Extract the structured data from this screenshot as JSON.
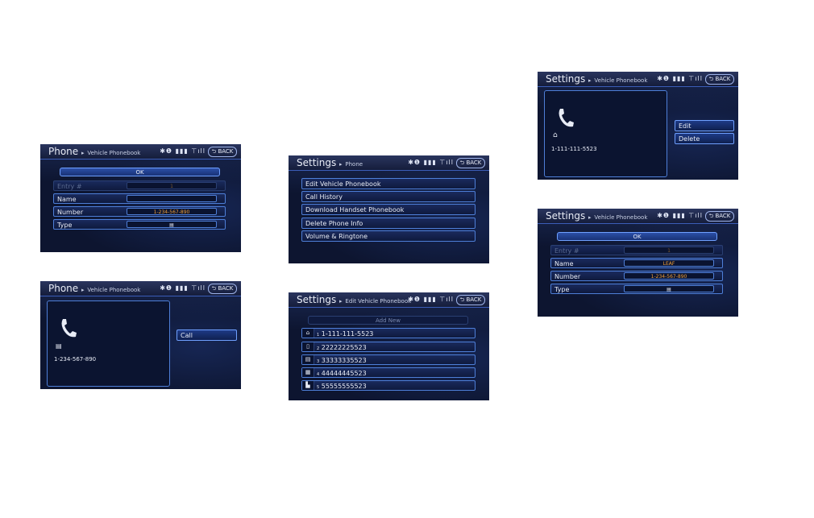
{
  "screens": {
    "a": {
      "title": "Phone",
      "subtitle": "Vehicle Phonebook",
      "back": "BACK",
      "ok": "OK",
      "rows": [
        {
          "label": "Entry #",
          "value": "1",
          "disabled": true
        },
        {
          "label": "Name",
          "value": ""
        },
        {
          "label": "Number",
          "value": "1-234-567-890"
        },
        {
          "label": "Type",
          "value": "▤"
        }
      ]
    },
    "b": {
      "title": "Phone",
      "subtitle": "Vehicle Phonebook",
      "back": "BACK",
      "type_glyph": "▤",
      "number": "1-234-567-890",
      "call": "Call"
    },
    "c": {
      "title": "Settings",
      "subtitle": "Phone",
      "back": "BACK",
      "menu": [
        "Edit Vehicle Phonebook",
        "Call History",
        "Download Handset Phonebook",
        "Delete Phone Info",
        "Volume & Ringtone"
      ]
    },
    "d": {
      "title": "Settings",
      "subtitle": "Edit Vehicle Phonebook",
      "back": "BACK",
      "add_new": "Add New",
      "entries": [
        {
          "icon": "home-icon",
          "glyph": "⌂",
          "index": "1",
          "number": "1-111-111-5523"
        },
        {
          "icon": "mobile-icon",
          "glyph": "▯",
          "index": "2",
          "number": "22222225523"
        },
        {
          "icon": "work-icon",
          "glyph": "▤",
          "index": "3",
          "number": "33333335523"
        },
        {
          "icon": "building-icon",
          "glyph": "▦",
          "index": "4",
          "number": "44444445523"
        },
        {
          "icon": "other-icon",
          "glyph": "▙",
          "index": "5",
          "number": "55555555523"
        }
      ]
    },
    "e": {
      "title": "Settings",
      "subtitle": "Vehicle Phonebook",
      "back": "BACK",
      "type_glyph": "⌂",
      "number": "1-111-111-5523",
      "edit": "Edit",
      "delete": "Delete"
    },
    "f": {
      "title": "Settings",
      "subtitle": "Vehicle Phonebook",
      "back": "BACK",
      "ok": "OK",
      "rows": [
        {
          "label": "Entry #",
          "value": "1",
          "disabled": true
        },
        {
          "label": "Name",
          "value": "LEAF"
        },
        {
          "label": "Number",
          "value": "1-234-567-890"
        },
        {
          "label": "Type",
          "value": "▤"
        }
      ]
    }
  },
  "status_icons": "✱❶ ▮▮▮ ⊤ıll"
}
